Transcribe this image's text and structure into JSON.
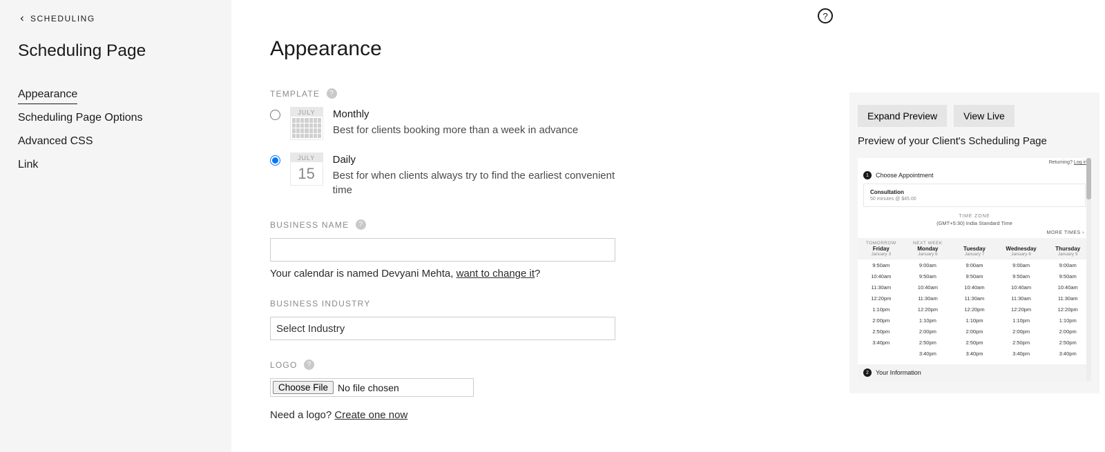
{
  "sidebar": {
    "back_label": "SCHEDULING",
    "title": "Scheduling Page",
    "items": [
      {
        "label": "Appearance",
        "active": true
      },
      {
        "label": "Scheduling Page Options",
        "active": false
      },
      {
        "label": "Advanced CSS",
        "active": false
      },
      {
        "label": "Link",
        "active": false
      }
    ]
  },
  "main": {
    "heading": "Appearance",
    "template": {
      "label": "TEMPLATE",
      "options": [
        {
          "id": "monthly",
          "title": "Monthly",
          "desc": "Best for clients booking more than a week in advance",
          "icon_month": "JULY",
          "selected": false
        },
        {
          "id": "daily",
          "title": "Daily",
          "desc": "Best for when clients always try to find the earliest convenient time",
          "icon_month": "JULY",
          "icon_day": "15",
          "selected": true
        }
      ]
    },
    "business_name": {
      "label": "BUSINESS NAME",
      "value": "",
      "hint_prefix": "Your calendar is named ",
      "hint_name": "Devyani Mehta",
      "hint_link": "want to change it",
      "hint_suffix": "?"
    },
    "business_industry": {
      "label": "BUSINESS INDUSTRY",
      "placeholder": "Select Industry"
    },
    "logo": {
      "label": "LOGO",
      "choose_label": "Choose File",
      "no_file": "No file chosen",
      "need_prefix": "Need a logo? ",
      "need_link": "Create one now"
    }
  },
  "preview": {
    "buttons": {
      "expand": "Expand Preview",
      "live": "View Live"
    },
    "caption": "Preview of your Client's Scheduling Page",
    "returning": "Returning?",
    "login": "Log in",
    "step1": "Choose Appointment",
    "consult_name": "Consultation",
    "consult_detail": "50 minutes @ $45.00",
    "tz_label": "TIME ZONE",
    "tz_value": "(GMT+5:30) India Standard Time",
    "more_times": "MORE TIMES",
    "columns": [
      {
        "rel": "TOMORROW",
        "dow": "Friday",
        "date": "January 3"
      },
      {
        "rel": "NEXT WEEK",
        "dow": "Monday",
        "date": "January 6"
      },
      {
        "rel": "",
        "dow": "Tuesday",
        "date": "January 7"
      },
      {
        "rel": "",
        "dow": "Wednesday",
        "date": "January 8"
      },
      {
        "rel": "",
        "dow": "Thursday",
        "date": "January 9"
      }
    ],
    "slots": [
      [
        "9:50am",
        "9:00am",
        "9:00am",
        "9:00am",
        "9:00am"
      ],
      [
        "10:40am",
        "9:50am",
        "9:50am",
        "9:50am",
        "9:50am"
      ],
      [
        "11:30am",
        "10:40am",
        "10:40am",
        "10:40am",
        "10:40am"
      ],
      [
        "12:20pm",
        "11:30am",
        "11:30am",
        "11:30am",
        "11:30am"
      ],
      [
        "1:10pm",
        "12:20pm",
        "12:20pm",
        "12:20pm",
        "12:20pm"
      ],
      [
        "2:00pm",
        "1:10pm",
        "1:10pm",
        "1:10pm",
        "1:10pm"
      ],
      [
        "2:50pm",
        "2:00pm",
        "2:00pm",
        "2:00pm",
        "2:00pm"
      ],
      [
        "3:40pm",
        "2:50pm",
        "2:50pm",
        "2:50pm",
        "2:50pm"
      ],
      [
        "",
        "3:40pm",
        "3:40pm",
        "3:40pm",
        "3:40pm"
      ]
    ],
    "step2": "Your Information"
  }
}
